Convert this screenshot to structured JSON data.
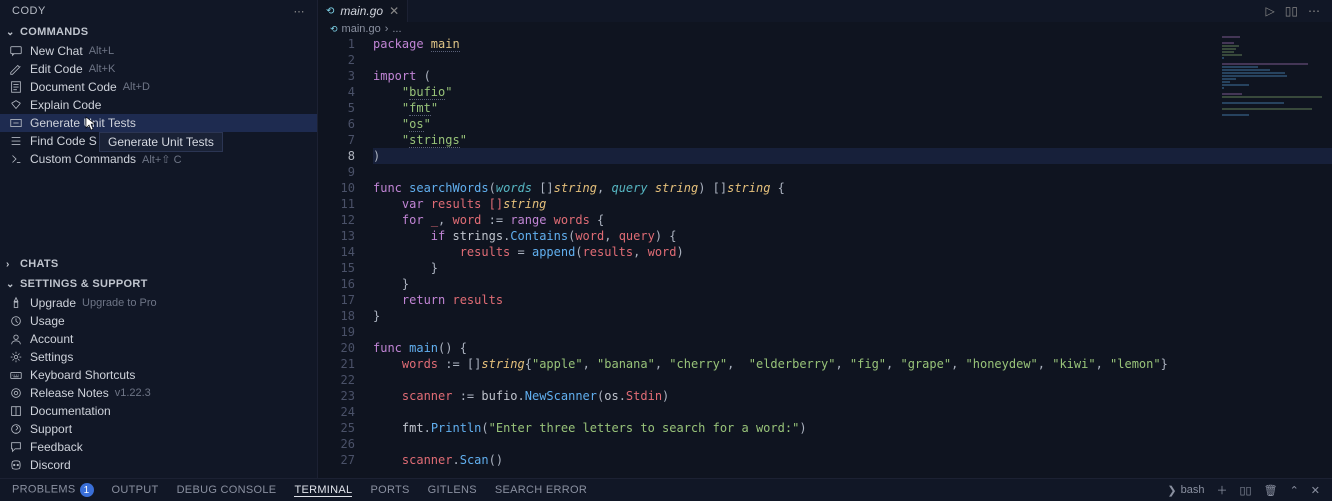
{
  "sidebar": {
    "title": "CODY",
    "sections": {
      "commands": {
        "label": "COMMANDS",
        "items": [
          {
            "label": "New Chat",
            "shortcut": "Alt+L"
          },
          {
            "label": "Edit Code",
            "shortcut": "Alt+K"
          },
          {
            "label": "Document Code",
            "shortcut": "Alt+D"
          },
          {
            "label": "Explain Code",
            "shortcut": ""
          },
          {
            "label": "Generate Unit Tests",
            "shortcut": ""
          },
          {
            "label": "Find Code Smells",
            "shortcut": ""
          },
          {
            "label": "Custom Commands",
            "shortcut": "Alt+⇧ C"
          }
        ]
      },
      "chats": {
        "label": "CHATS"
      },
      "settings": {
        "label": "SETTINGS & SUPPORT",
        "items": [
          {
            "label": "Upgrade",
            "hint": "Upgrade to Pro"
          },
          {
            "label": "Usage",
            "hint": ""
          },
          {
            "label": "Account",
            "hint": ""
          },
          {
            "label": "Settings",
            "hint": ""
          },
          {
            "label": "Keyboard Shortcuts",
            "hint": ""
          },
          {
            "label": "Release Notes",
            "hint": "v1.22.3"
          },
          {
            "label": "Documentation",
            "hint": ""
          },
          {
            "label": "Support",
            "hint": ""
          },
          {
            "label": "Feedback",
            "hint": ""
          },
          {
            "label": "Discord",
            "hint": ""
          }
        ]
      }
    },
    "tooltip": "Generate Unit Tests"
  },
  "editor": {
    "tab": {
      "name": "main.go"
    },
    "breadcrumb": {
      "file": "main.go",
      "sep": "›",
      "rest": "..."
    },
    "code": [
      [
        [
          "package ",
          "kw"
        ],
        [
          "main",
          "pkg"
        ]
      ],
      [],
      [
        [
          "import ",
          "kw"
        ],
        [
          "(",
          "punct"
        ]
      ],
      [
        [
          "    \"",
          "str"
        ],
        [
          "bufio",
          "str-u"
        ],
        [
          "\"",
          "str"
        ]
      ],
      [
        [
          "    \"",
          "str"
        ],
        [
          "fmt",
          "str-u"
        ],
        [
          "\"",
          "str"
        ]
      ],
      [
        [
          "    \"",
          "str"
        ],
        [
          "os",
          "str-u"
        ],
        [
          "\"",
          "str"
        ]
      ],
      [
        [
          "    \"",
          "str"
        ],
        [
          "strings",
          "str-u"
        ],
        [
          "\"",
          "str"
        ]
      ],
      [
        [
          ")",
          "punct"
        ]
      ],
      [],
      [
        [
          "func ",
          "kw"
        ],
        [
          "searchWords",
          "func"
        ],
        [
          "(",
          "punct"
        ],
        [
          "words",
          "ident"
        ],
        [
          " []",
          "punct"
        ],
        [
          "string",
          "type"
        ],
        [
          ", ",
          "punct"
        ],
        [
          "query",
          "ident"
        ],
        [
          " ",
          "plain"
        ],
        [
          "string",
          "type"
        ],
        [
          ") []",
          "punct"
        ],
        [
          "string",
          "type"
        ],
        [
          " {",
          "punct"
        ]
      ],
      [
        [
          "    ",
          "plain"
        ],
        [
          "var ",
          "kw"
        ],
        [
          "results []",
          "var"
        ],
        [
          "string",
          "type"
        ]
      ],
      [
        [
          "    ",
          "plain"
        ],
        [
          "for ",
          "kw"
        ],
        [
          "_",
          "var"
        ],
        [
          ", ",
          "punct"
        ],
        [
          "word",
          "var"
        ],
        [
          " := ",
          "punct"
        ],
        [
          "range ",
          "kw"
        ],
        [
          "words",
          "var"
        ],
        [
          " {",
          "punct"
        ]
      ],
      [
        [
          "        ",
          "plain"
        ],
        [
          "if ",
          "kw"
        ],
        [
          "strings",
          "plain"
        ],
        [
          ".",
          "punct"
        ],
        [
          "Contains",
          "func"
        ],
        [
          "(",
          "punct"
        ],
        [
          "word",
          "var"
        ],
        [
          ", ",
          "punct"
        ],
        [
          "query",
          "var"
        ],
        [
          ") {",
          "punct"
        ]
      ],
      [
        [
          "            ",
          "plain"
        ],
        [
          "results",
          "var"
        ],
        [
          " = ",
          "punct"
        ],
        [
          "append",
          "func"
        ],
        [
          "(",
          "punct"
        ],
        [
          "results",
          "var"
        ],
        [
          ", ",
          "punct"
        ],
        [
          "word",
          "var"
        ],
        [
          ")",
          "punct"
        ]
      ],
      [
        [
          "        }",
          "punct"
        ]
      ],
      [
        [
          "    }",
          "punct"
        ]
      ],
      [
        [
          "    ",
          "plain"
        ],
        [
          "return ",
          "kw"
        ],
        [
          "results",
          "var"
        ]
      ],
      [
        [
          "}",
          "punct"
        ]
      ],
      [],
      [
        [
          "func ",
          "kw"
        ],
        [
          "main",
          "func"
        ],
        [
          "() {",
          "punct"
        ]
      ],
      [
        [
          "    ",
          "plain"
        ],
        [
          "words",
          "var"
        ],
        [
          " := []",
          "punct"
        ],
        [
          "string",
          "type"
        ],
        [
          "{",
          "punct"
        ],
        [
          "\"apple\"",
          "str"
        ],
        [
          ", ",
          "punct"
        ],
        [
          "\"banana\"",
          "str"
        ],
        [
          ", ",
          "punct"
        ],
        [
          "\"cherry\"",
          "str"
        ],
        [
          ",  ",
          "punct"
        ],
        [
          "\"elderberry\"",
          "str"
        ],
        [
          ", ",
          "punct"
        ],
        [
          "\"fig\"",
          "str"
        ],
        [
          ", ",
          "punct"
        ],
        [
          "\"grape\"",
          "str"
        ],
        [
          ", ",
          "punct"
        ],
        [
          "\"honeydew\"",
          "str"
        ],
        [
          ", ",
          "punct"
        ],
        [
          "\"kiwi\"",
          "str"
        ],
        [
          ", ",
          "punct"
        ],
        [
          "\"lemon\"",
          "str"
        ],
        [
          "}",
          "punct"
        ]
      ],
      [],
      [
        [
          "    ",
          "plain"
        ],
        [
          "scanner",
          "var"
        ],
        [
          " := ",
          "punct"
        ],
        [
          "bufio",
          "plain"
        ],
        [
          ".",
          "punct"
        ],
        [
          "NewScanner",
          "func"
        ],
        [
          "(",
          "punct"
        ],
        [
          "os",
          "plain"
        ],
        [
          ".",
          "punct"
        ],
        [
          "Stdin",
          "var"
        ],
        [
          ")",
          "punct"
        ]
      ],
      [],
      [
        [
          "    ",
          "plain"
        ],
        [
          "fmt",
          "plain"
        ],
        [
          ".",
          "punct"
        ],
        [
          "Println",
          "func"
        ],
        [
          "(",
          "punct"
        ],
        [
          "\"Enter three letters to search for a word:\"",
          "str"
        ],
        [
          ")",
          "punct"
        ]
      ],
      [],
      [
        [
          "    ",
          "plain"
        ],
        [
          "scanner",
          "var"
        ],
        [
          ".",
          "punct"
        ],
        [
          "Scan",
          "func"
        ],
        [
          "()",
          "punct"
        ]
      ]
    ],
    "highlight_line": 8
  },
  "panel": {
    "tabs": [
      {
        "label": "PROBLEMS",
        "badge": "1"
      },
      {
        "label": "OUTPUT"
      },
      {
        "label": "DEBUG CONSOLE"
      },
      {
        "label": "TERMINAL",
        "active": true
      },
      {
        "label": "PORTS"
      },
      {
        "label": "GITLENS"
      },
      {
        "label": "SEARCH ERROR"
      }
    ],
    "terminal": "bash"
  }
}
